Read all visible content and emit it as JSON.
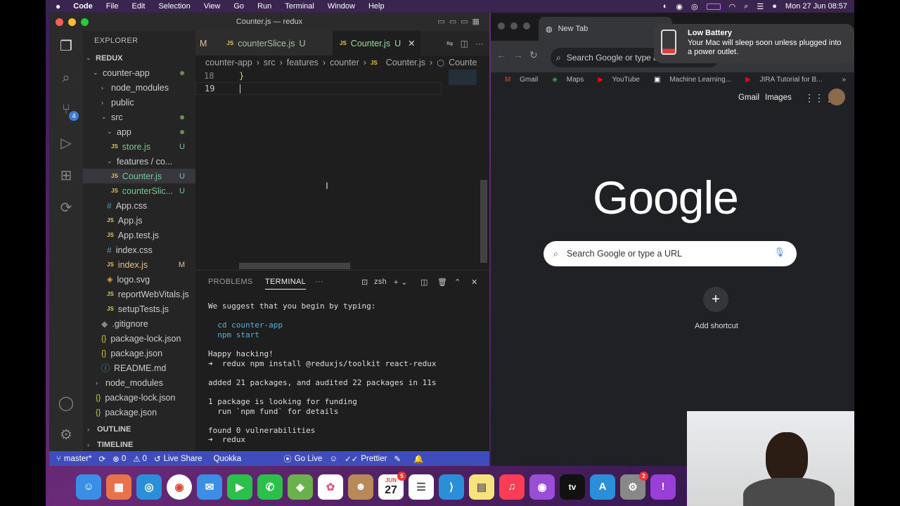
{
  "menubar": {
    "app": "Code",
    "items": [
      "File",
      "Edit",
      "Selection",
      "View",
      "Go",
      "Run",
      "Terminal",
      "Window",
      "Help"
    ],
    "datetime": "Mon 27 Jun  08:57"
  },
  "vscode": {
    "window_title": "Counter.js — redux",
    "explorer_label": "EXPLORER",
    "root": "REDUX",
    "tree": [
      {
        "label": "counter-app",
        "type": "folder-open"
      },
      {
        "label": "node_modules",
        "type": "folder"
      },
      {
        "label": "public",
        "type": "folder"
      },
      {
        "label": "src",
        "type": "folder-open"
      },
      {
        "label": "app",
        "type": "folder-open"
      },
      {
        "label": "store.js",
        "type": "js",
        "badge": "U"
      },
      {
        "label": "features / co...",
        "type": "folder-open"
      },
      {
        "label": "Counter.js",
        "type": "js",
        "badge": "U"
      },
      {
        "label": "counterSlic...",
        "type": "js",
        "badge": "U"
      },
      {
        "label": "App.css",
        "type": "css"
      },
      {
        "label": "App.js",
        "type": "js"
      },
      {
        "label": "App.test.js",
        "type": "js"
      },
      {
        "label": "index.css",
        "type": "css"
      },
      {
        "label": "index.js",
        "type": "js",
        "badge": "M"
      },
      {
        "label": "logo.svg",
        "type": "svg"
      },
      {
        "label": "reportWebVitals.js",
        "type": "js"
      },
      {
        "label": "setupTests.js",
        "type": "js"
      },
      {
        "label": ".gitignore",
        "type": "git"
      },
      {
        "label": "package-lock.json",
        "type": "json"
      },
      {
        "label": "package.json",
        "type": "json"
      },
      {
        "label": "README.md",
        "type": "md"
      },
      {
        "label": "node_modules",
        "type": "folder"
      },
      {
        "label": "package-lock.json",
        "type": "json"
      },
      {
        "label": "package.json",
        "type": "json"
      }
    ],
    "outline": "OUTLINE",
    "timeline": "TIMELINE",
    "tabs": [
      {
        "label": "counterSlice.js",
        "badge": "U",
        "prefix": "M"
      },
      {
        "label": "Counter.js",
        "badge": "U"
      }
    ],
    "breadcrumbs": [
      "counter-app",
      "src",
      "features",
      "counter",
      "Counter.js",
      "Counte"
    ],
    "lines": [
      {
        "num": "18",
        "code": "}"
      },
      {
        "num": "19",
        "code": ""
      }
    ],
    "panel_tabs": [
      "PROBLEMS",
      "TERMINAL"
    ],
    "shell": "zsh",
    "terminal": [
      "We suggest that you begin by typing:",
      "",
      "  cd counter-app",
      "  npm start",
      "",
      "Happy hacking!",
      "➜  redux npm install @reduxjs/toolkit react-redux",
      "",
      "added 21 packages, and audited 22 packages in 11s",
      "",
      "1 package is looking for funding",
      "  run `npm fund` for details",
      "",
      "found 0 vulnerabilities",
      "➜  redux "
    ],
    "status": {
      "branch": "master*",
      "problems": "0",
      "warnings": "0",
      "live_share": "Live Share",
      "quokka": "Quokka",
      "go_live": "Go Live",
      "prettier": "Prettier"
    }
  },
  "chrome": {
    "tab_title": "New Tab",
    "omnibox_placeholder": "Search Google or type a",
    "bookmarks": [
      "Gmail",
      "Maps",
      "YouTube",
      "Machine Learning...",
      "JIRA Tutorial for B..."
    ],
    "gmail": "Gmail",
    "images": "Images",
    "logo": "Google",
    "search_placeholder": "Search Google or type a URL",
    "add_shortcut": "Add shortcut"
  },
  "notification": {
    "title": "Low Battery",
    "body": "Your Mac will sleep soon unless plugged into a power outlet."
  },
  "dock": {
    "calendar_month": "JUN",
    "calendar_day": "27",
    "calendar_badge": "5",
    "settings_badge": "2"
  },
  "colors": {
    "status_bar": "#3e4cbc",
    "editor_bg": "#1e1e1e",
    "chrome_bg": "#202124"
  }
}
